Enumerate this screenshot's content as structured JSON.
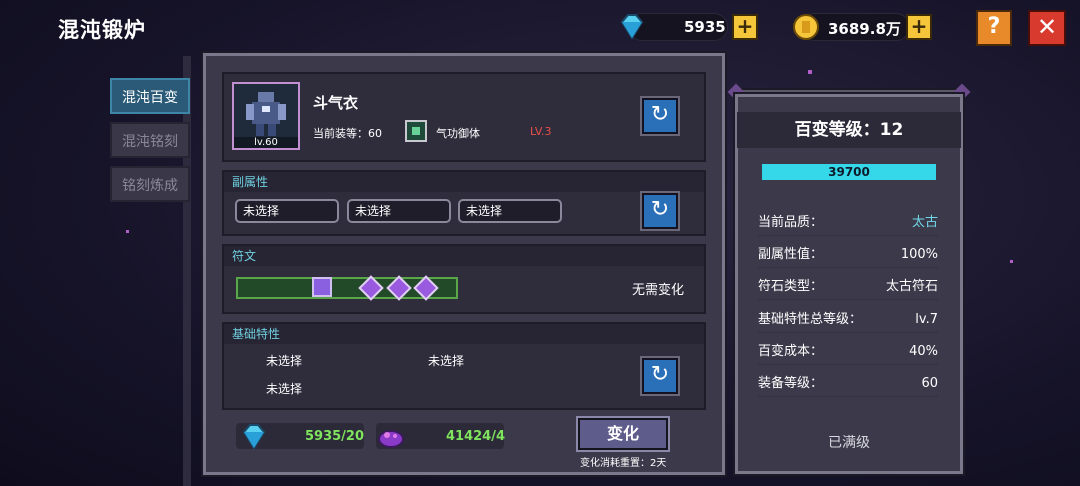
{
  "header": {
    "title": "混沌锻炉",
    "gems": "5935",
    "gold": "3689.8万",
    "plus": "+",
    "help": "?",
    "close": "✕"
  },
  "tabs": [
    {
      "label": "混沌百变",
      "active": true
    },
    {
      "label": "混沌铭刻",
      "active": false
    },
    {
      "label": "铭刻炼成",
      "active": false
    }
  ],
  "equipment": {
    "name": "斗气衣",
    "level_badge": "lv.60",
    "current_level_text": "当前装等：60",
    "skill_name": "气功御体",
    "skill_level": "LV.3"
  },
  "sub_attributes": {
    "header": "副属性",
    "slots": [
      "未选择",
      "未选择",
      "未选择"
    ]
  },
  "runes": {
    "header": "符文",
    "status": "无需变化"
  },
  "base_traits": {
    "header": "基础特性",
    "items": [
      "未选择",
      "未选择",
      "未选择"
    ]
  },
  "costs": {
    "gems": "5935/20",
    "material": "41424/4",
    "change_button": "变化",
    "reset_note": "变化消耗重置：2天"
  },
  "transform_panel": {
    "title": "百变等级：12",
    "progress_value": "39700",
    "progress_fraction": 1.0,
    "stats": [
      {
        "label": "当前品质：",
        "value": "太古",
        "accent": true
      },
      {
        "label": "副属性值：",
        "value": "100%",
        "accent": false
      },
      {
        "label": "符石类型：",
        "value": "太古符石",
        "accent": false
      },
      {
        "label": "基础特性总等级：",
        "value": "lv.7",
        "accent": false
      },
      {
        "label": "百变成本：",
        "value": "40%",
        "accent": false
      },
      {
        "label": "装备等级：",
        "value": "60",
        "accent": false
      }
    ],
    "max_text": "已满级"
  },
  "icons": {
    "refresh": "↻",
    "gem": "diamond-icon",
    "gold": "coin-icon"
  }
}
